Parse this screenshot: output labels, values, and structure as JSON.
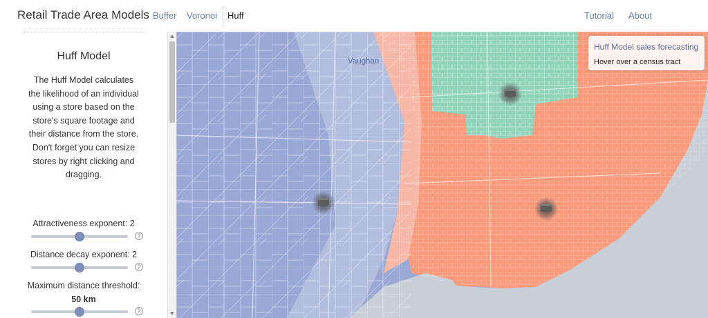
{
  "app": {
    "title": "Retail Trade Area Models"
  },
  "nav": {
    "left": [
      "Buffer",
      "Voronoi",
      "Huff"
    ],
    "active": "Huff",
    "right": [
      "Tutorial",
      "About"
    ]
  },
  "sidebar": {
    "title": "Huff Model",
    "description": "The Huff Model calculates the likelihood of an individual using a store based on the store's square footage and their distance from the store. Don't forget you can resize stores by right clicking and dragging.",
    "controls": [
      {
        "label": "Attractiveness exponent: 2",
        "fraction": 0.5,
        "help": "?"
      },
      {
        "label": "Distance decay exponent: 2",
        "fraction": 0.5,
        "help": "?"
      },
      {
        "label": "Maximum distance threshold:",
        "value_label": "50 km",
        "fraction": 0.5,
        "help": "?"
      }
    ]
  },
  "map": {
    "city_label": "Vaughan",
    "info": {
      "title": "Huff Model sales forecasting",
      "hint": "Hover over a census tract"
    },
    "colors": {
      "blue_zone": "#9aa8d6",
      "orange_zone": "#fa9a7a",
      "green_zone": "#8fd3bb",
      "lake": "#c9cfd6",
      "tract_lines": "#ffffff"
    },
    "stores": [
      {
        "name": "store-west",
        "icon": "store-icon"
      },
      {
        "name": "store-east",
        "icon": "store-icon"
      },
      {
        "name": "store-north",
        "icon": "store-icon"
      }
    ]
  }
}
